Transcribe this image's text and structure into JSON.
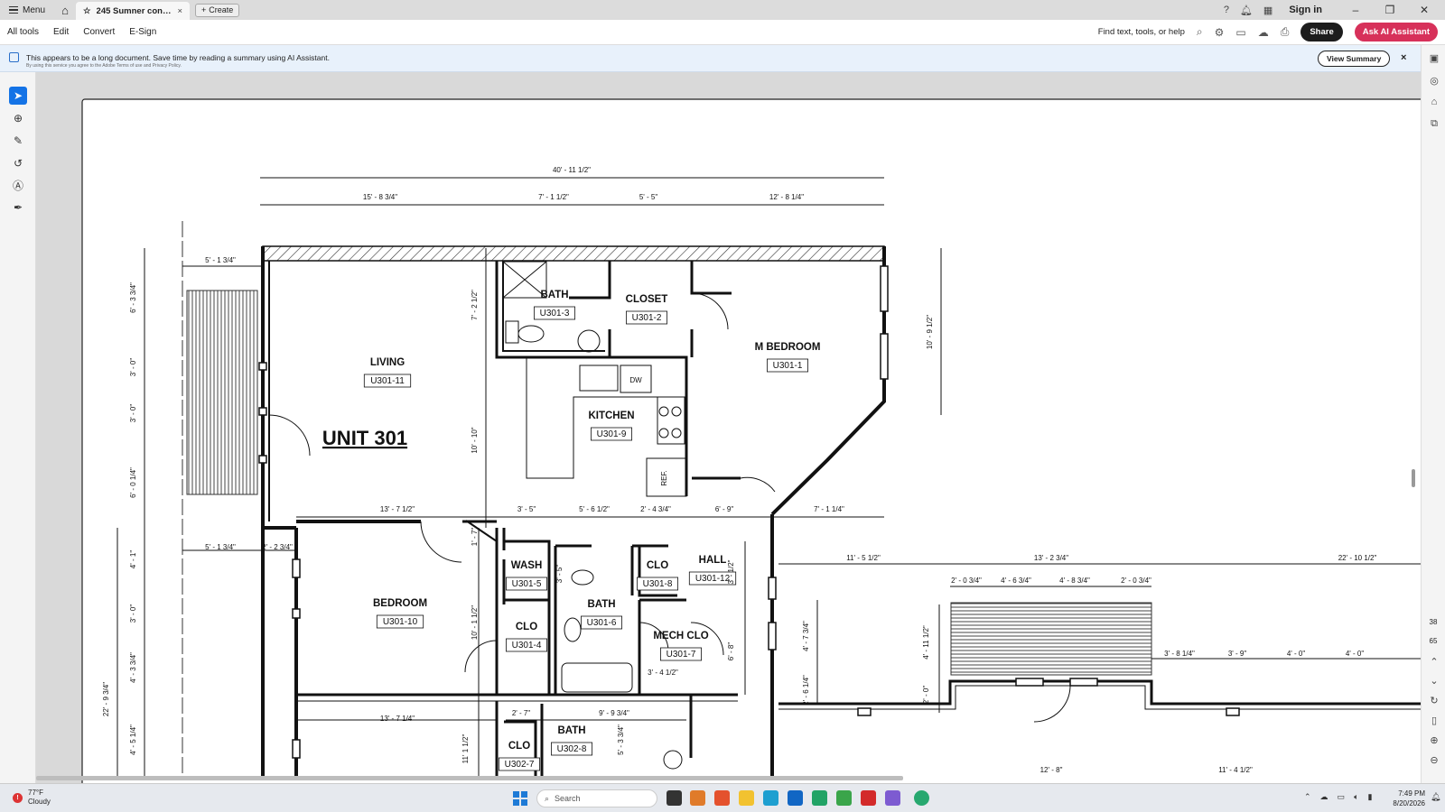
{
  "app": {
    "menu_label": "Menu",
    "tab_title": "245 Sumner constructi...",
    "create_label": "Create",
    "sign_in": "Sign in"
  },
  "menubar": {
    "items": [
      "All tools",
      "Edit",
      "Convert",
      "E-Sign"
    ],
    "find_label": "Find text, tools, or help",
    "share_label": "Share",
    "ai_label": "Ask AI Assistant"
  },
  "banner": {
    "text": "This appears to be a long document. Save time by reading a summary using AI Assistant.",
    "subtext": "By using this service you agree to the Adobe Terms of use and Privacy Policy.",
    "button": "View Summary",
    "close": "×"
  },
  "right_rail": {
    "page_current": "38",
    "page_total": "65"
  },
  "plan": {
    "unit_title": "UNIT 301",
    "rooms": [
      {
        "name": "LIVING",
        "tag": "U301-11"
      },
      {
        "name": "BATH",
        "tag": "U301-3"
      },
      {
        "name": "CLOSET",
        "tag": "U301-2"
      },
      {
        "name": "M BEDROOM",
        "tag": "U301-1"
      },
      {
        "name": "KITCHEN",
        "tag": "U301-9"
      },
      {
        "name": "BEDROOM",
        "tag": "U301-10"
      },
      {
        "name": "WASH",
        "tag": "U301-5"
      },
      {
        "name": "BATH",
        "tag": "U301-6"
      },
      {
        "name": "CLO",
        "tag": "U301-8"
      },
      {
        "name": "HALL",
        "tag": "U301-12"
      },
      {
        "name": "CLO",
        "tag": "U301-4"
      },
      {
        "name": "MECH CLO",
        "tag": "U301-7"
      },
      {
        "name": "CLO",
        "tag": "U302-7"
      },
      {
        "name": "BATH",
        "tag": "U302-8"
      }
    ],
    "fixtures": {
      "dw": "DW",
      "ref": "REF."
    },
    "dims_h": [
      "40' - 11 1/2\"",
      "15' - 8 3/4\"",
      "7' - 1 1/2\"",
      "5' - 5\"",
      "12' - 8 1/4\"",
      "5' - 1 3/4\"",
      "13' - 7 1/2\"",
      "3' - 5\"",
      "5' - 6 1/2\"",
      "2' - 4 3/4\"",
      "6' - 9\"",
      "7' - 1 1/4\"",
      "5' - 1 3/4\"",
      "2' - 2 3/4\"",
      "11' - 5 1/2\"",
      "13' - 2 3/4\"",
      "22' - 10 1/2\"",
      "2' - 0 3/4\"",
      "4' - 6 3/4\"",
      "4' - 8 3/4\"",
      "2' - 0 3/4\"",
      "3' - 8 1/4\"",
      "3' - 9\"",
      "4' - 0\"",
      "4' - 0\"",
      "13' - 7 1/4\"",
      "2' - 7\"",
      "9' - 9 3/4\"",
      "3' - 4 1/2\"",
      "12' - 8\"",
      "11' - 4 1/2\""
    ],
    "dims_v": [
      "6' - 3 3/4\"",
      "3' - 0\"",
      "3' - 0\"",
      "6' - 0 1/4\"",
      "4' - 1\"",
      "3' - 0\"",
      "4' - 3 3/4\"",
      "22' - 9 3/4\"",
      "4' - 5 1/4\"",
      "7' - 2 1/2\"",
      "10' - 10\"",
      "10' - 9 1/2\"",
      "1' - 7\"",
      "10' - 1 1/2\"",
      "11' 1 1/2\"",
      "3' - 5\"",
      "3' - 1/2\"",
      "6' - 8\"",
      "5' - 3 3/4\"",
      "4' - 7 3/4\"",
      "2' - 6 1/4\"",
      "4' - 11 1/2\"",
      "2' - 0\""
    ]
  },
  "taskbar": {
    "temp": "77°F",
    "weather": "Cloudy",
    "search": "Search",
    "time": "7:49 PM",
    "date": "8/20/2026"
  },
  "colors": {
    "accent": "#1473e6",
    "ai_button": "#d7315a",
    "banner_bg": "#e8f1fb"
  }
}
